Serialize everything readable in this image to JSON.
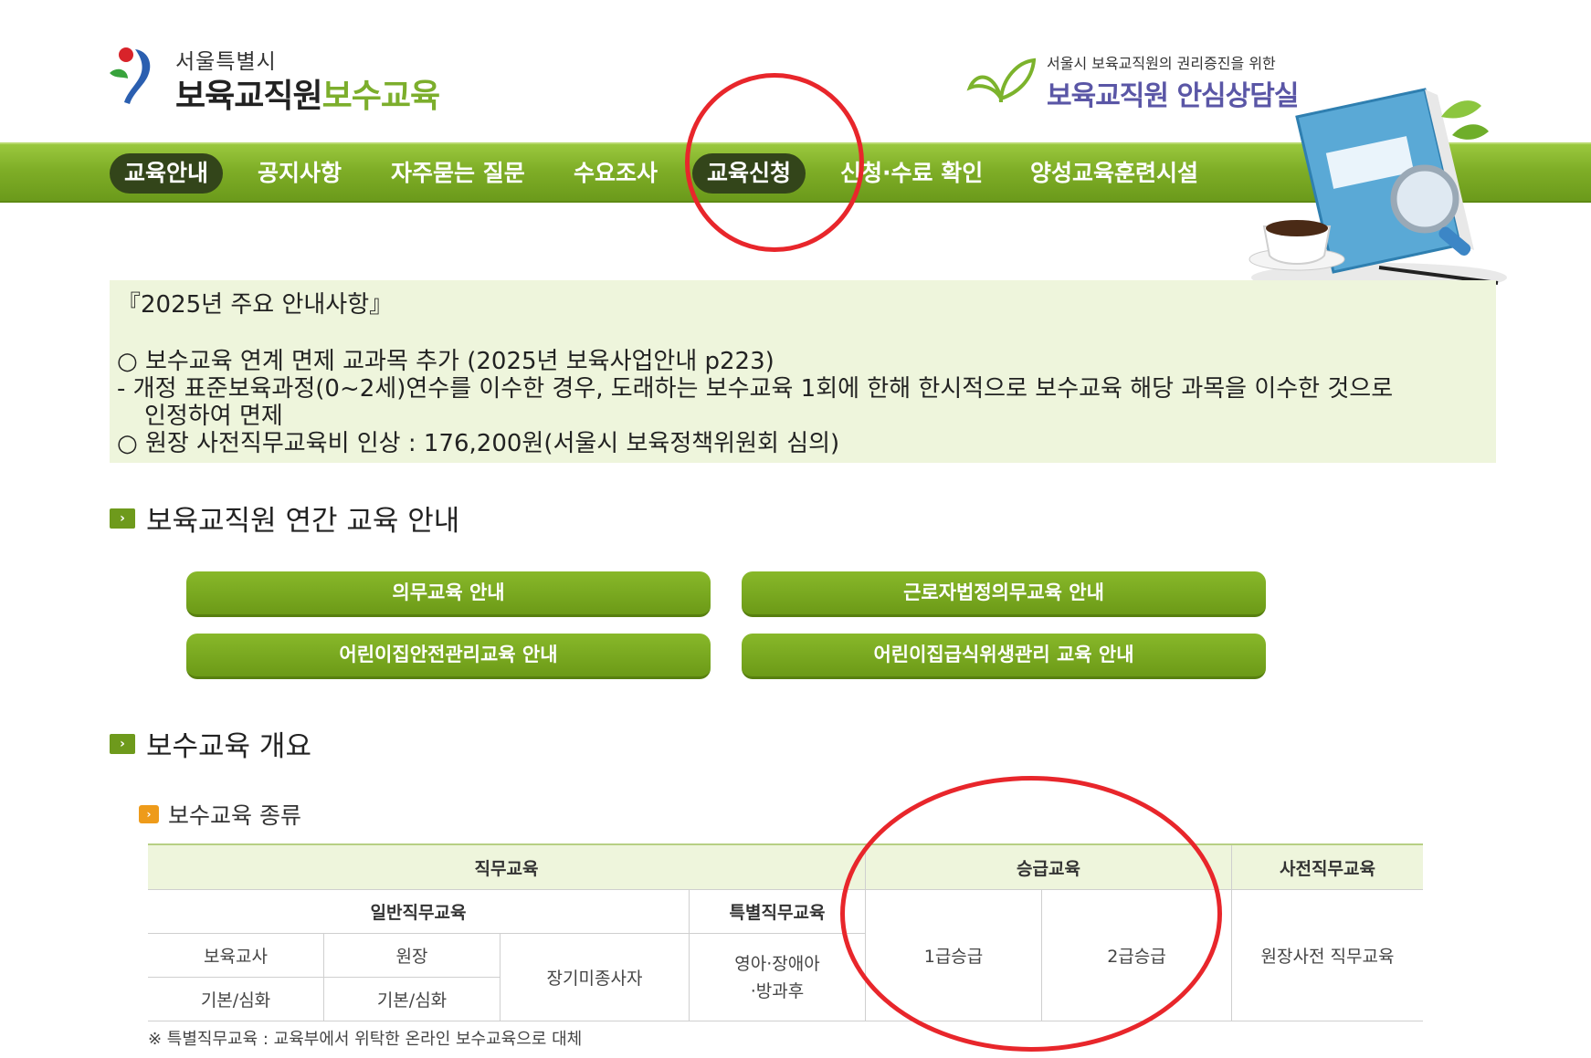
{
  "header": {
    "logo_city": "서울특별시",
    "logo_title_main": "보육교직원",
    "logo_title_accent": "보수교육",
    "counsel_sub": "서울시 보육교직원의 권리증진을 위한",
    "counsel_main": "보육교직원 안심상담실"
  },
  "nav": {
    "items": [
      {
        "label": "교육안내",
        "active": true
      },
      {
        "label": "공지사항"
      },
      {
        "label": "자주묻는 질문"
      },
      {
        "label": "수요조사"
      },
      {
        "label": "교육신청",
        "active": true
      },
      {
        "label": "신청·수료 확인"
      },
      {
        "label": "양성교육훈련시설"
      }
    ]
  },
  "notice": {
    "title": "『2025년 주요 안내사항』",
    "line1": "○ 보수교육 연계 면제 교과목 추가 (2025년 보육사업안내 p223)",
    "line2": " - 개정 표준보육과정(0~2세)연수를 이수한 경우, 도래하는 보수교육 1회에 한해 한시적으로 보수교육 해당 과목을 이수한 것으로",
    "line3": "인정하여 면제",
    "line4": "○ 원장 사전직무교육비 인상 : 176,200원(서울시 보육정책위원회 심의)"
  },
  "section_annual": {
    "title": "보육교직원 연간 교육 안내",
    "buttons": [
      "의무교육 안내",
      "근로자법정의무교육 안내",
      "어린이집안전관리교육 안내",
      "어린이집급식위생관리 교육 안내"
    ]
  },
  "section_overview": {
    "title": "보수교육 개요",
    "subtitle": "보수교육 종류"
  },
  "table": {
    "h_duty": "직무교육",
    "h_promotion": "승급교육",
    "h_predirector": "사전직무교육",
    "h_general": "일반직무교육",
    "h_special": "특별직무교육",
    "c_teacher": "보육교사",
    "c_director": "원장",
    "c_longterm": "장기미종사자",
    "c_special_line1": "영아·장애아",
    "c_special_line2": "·방과후",
    "c_grade1": "1급승급",
    "c_grade2": "2급승급",
    "c_predirector": "원장사전 직무교육",
    "c_basic1": "기본/심화",
    "c_basic2": "기본/심화",
    "footnote": "※ 특별직무교육 : 교육부에서 위탁한 온라인 보수교육으로 대체"
  },
  "colors": {
    "nav_green": "#7fae27",
    "button_green": "#7aa823",
    "notice_bg": "#eef5dc",
    "annotation_red": "#e8262b",
    "counsel_purple": "#5a56a6"
  }
}
